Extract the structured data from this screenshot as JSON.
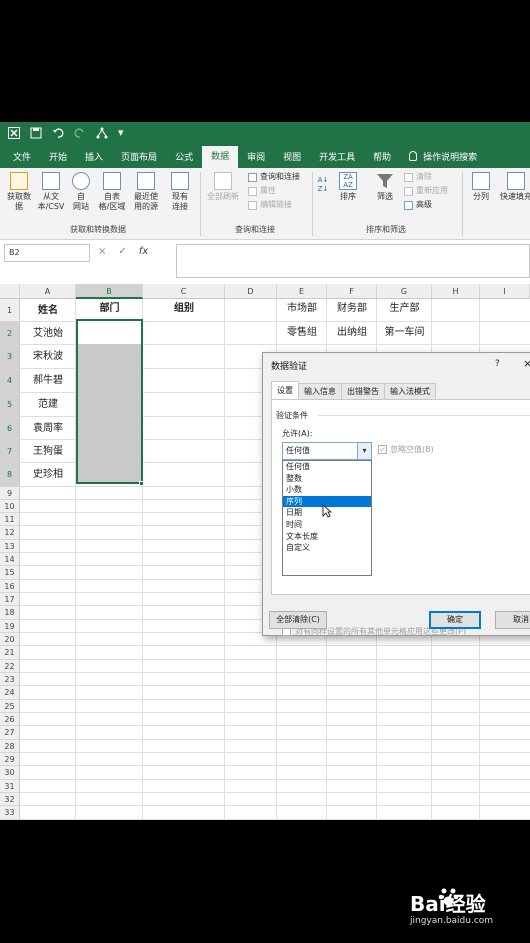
{
  "quick_access": {
    "title": "…"
  },
  "tabs": [
    "文件",
    "开始",
    "插入",
    "页面布局",
    "公式",
    "数据",
    "审阅",
    "视图",
    "开发工具",
    "帮助",
    "操作说明搜索"
  ],
  "ribbon": {
    "get_data": "获取数\n据",
    "from_text": "从文\n本/CSV",
    "from_web": "自\n网站",
    "from_table": "自表\n格/区域",
    "recent_sources": "最近使\n用的源",
    "existing_conn": "现有\n连接",
    "refresh_all": "全部刷新",
    "queries_conn": "查询和连接",
    "properties": "属性",
    "edit_links": "编辑链接",
    "sort": "排序",
    "filter": "筛选",
    "clear": "清除",
    "reapply": "重新应用",
    "advanced": "高级",
    "split": "分列",
    "flash_fill": "快速填充",
    "group_get": "获取和转换数据",
    "group_query": "查询和连接",
    "group_sort": "排序和筛选"
  },
  "formula_bar": {
    "name_box": "B2",
    "fx": "fx",
    "cancel": "×",
    "enter": "✓"
  },
  "columns": [
    "A",
    "B",
    "C",
    "D",
    "E",
    "F",
    "G",
    "H",
    "I"
  ],
  "rows": [
    "1",
    "2",
    "3",
    "4",
    "5",
    "6",
    "7",
    "8",
    "9",
    "10",
    "11",
    "12",
    "13",
    "14",
    "15",
    "16",
    "17",
    "18",
    "19",
    "20",
    "21",
    "22",
    "23",
    "24",
    "25",
    "26",
    "27",
    "28",
    "29",
    "30",
    "31",
    "32",
    "33"
  ],
  "cells": {
    "A1": "姓名",
    "B1": "部门",
    "C1": "组别",
    "A2": "艾池始",
    "A3": "宋秋波",
    "A4": "郝牛碧",
    "A5": "范建",
    "A6": "袁周率",
    "A7": "王狗蛋",
    "A8": "史珍相",
    "E1": "市场部",
    "F1": "财务部",
    "G1": "生产部",
    "E2": "零售组",
    "F2": "出纳组",
    "G2": "第一车间"
  },
  "dialog": {
    "title": "数据验证",
    "help": "?",
    "close": "×",
    "tabs": [
      "设置",
      "输入信息",
      "出错警告",
      "输入法模式"
    ],
    "criteria_label": "验证条件",
    "allow_label": "允许(A):",
    "allow_value": "任何值",
    "ignore_blank": "忽略空值(B)",
    "options": [
      "任何值",
      "整数",
      "小数",
      "序列",
      "日期",
      "时间",
      "文本长度",
      "自定义"
    ],
    "highlighted_option": "序列",
    "apply_all": "对有同样设置的所有其他单元格应用这些更改(P)",
    "clear_all": "全部清除(C)",
    "ok": "确定",
    "cancel": "取消"
  },
  "watermark": {
    "brand": "Bai经验",
    "url": "jingyan.baidu.com"
  }
}
